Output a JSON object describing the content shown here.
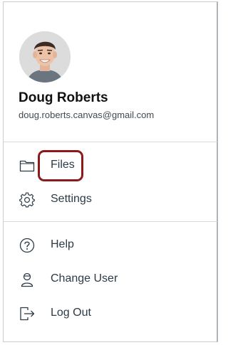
{
  "user": {
    "name": "Doug Roberts",
    "email": "doug.roberts.canvas@gmail.com"
  },
  "menu": {
    "primary": [
      {
        "label": "Files",
        "icon": "folder-icon"
      },
      {
        "label": "Settings",
        "icon": "gear-icon"
      }
    ],
    "secondary": [
      {
        "label": "Help",
        "icon": "help-icon"
      },
      {
        "label": "Change User",
        "icon": "change-user-icon"
      },
      {
        "label": "Log Out",
        "icon": "logout-icon"
      }
    ]
  },
  "colors": {
    "text": "#2d3b45",
    "highlight": "#8b1a1a",
    "divider": "#d7dadc"
  }
}
